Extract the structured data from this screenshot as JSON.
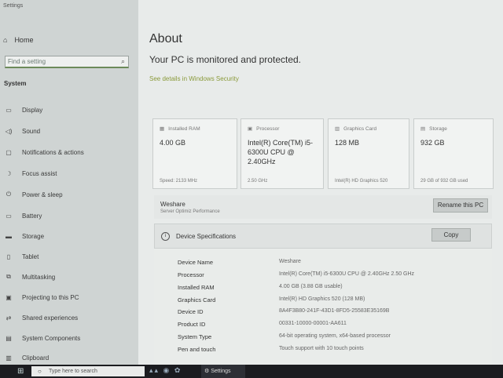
{
  "app": {
    "title": "Settings"
  },
  "sidebar": {
    "home_label": "Home",
    "search_placeholder": "Find a setting",
    "section_label": "System",
    "items": [
      {
        "label": "Display",
        "icon": "monitor-icon"
      },
      {
        "label": "Sound",
        "icon": "speaker-icon"
      },
      {
        "label": "Notifications & actions",
        "icon": "notification-icon"
      },
      {
        "label": "Focus assist",
        "icon": "moon-icon"
      },
      {
        "label": "Power & sleep",
        "icon": "power-icon"
      },
      {
        "label": "Battery",
        "icon": "battery-icon"
      },
      {
        "label": "Storage",
        "icon": "storage-icon"
      },
      {
        "label": "Tablet",
        "icon": "tablet-icon"
      },
      {
        "label": "Multitasking",
        "icon": "multitasking-icon"
      },
      {
        "label": "Projecting to this PC",
        "icon": "projector-icon"
      },
      {
        "label": "Shared experiences",
        "icon": "shared-icon"
      },
      {
        "label": "System Components",
        "icon": "components-icon"
      },
      {
        "label": "Clipboard",
        "icon": "clipboard-icon"
      }
    ]
  },
  "main": {
    "title": "About",
    "protection_status": "Your PC is monitored and protected.",
    "security_link": "See details in Windows Security",
    "cards": [
      {
        "header": "Installed RAM",
        "value": "4.00 GB",
        "footer": "Speed: 2133 MHz",
        "icon": "ram-icon"
      },
      {
        "header": "Processor",
        "value": "Intel(R) Core(TM) i5-6300U CPU @ 2.40GHz",
        "footer": "2.50 GHz",
        "icon": "processor-icon"
      },
      {
        "header": "Graphics Card",
        "value": "128 MB",
        "footer": "Intel(R) HD Graphics 520",
        "icon": "graphics-icon"
      },
      {
        "header": "Storage",
        "value": "932 GB",
        "footer": "29 GB of 932 GB used",
        "icon": "storage-icon"
      }
    ],
    "device": {
      "name": "Weshare",
      "subtitle": "Server Optimiz Performance",
      "rename_button": "Rename this PC"
    },
    "specs": {
      "title": "Device Specifications",
      "copy_button": "Copy",
      "rows": [
        {
          "key": "Device Name",
          "value": "Weshare"
        },
        {
          "key": "Processor",
          "value": "Intel(R) Core(TM) i5-6300U CPU @ 2.40GHz   2.50 GHz"
        },
        {
          "key": "Installed RAM",
          "value": "4.00 GB (3.88 GB usable)"
        },
        {
          "key": "Graphics Card",
          "value": "Intel(R) HD Graphics 520 (128 MB)"
        },
        {
          "key": "Device ID",
          "value": "8A4F3B80-241F-43D1-8FD5-25583E35169B"
        },
        {
          "key": "Product ID",
          "value": "00331-10000-00001-AA611"
        },
        {
          "key": "System Type",
          "value": "64-bit operating system, x64-based processor"
        },
        {
          "key": "Pen and touch",
          "value": "Touch support with 10 touch points"
        }
      ]
    }
  },
  "taskbar": {
    "search_placeholder": "Type here to search",
    "active_app": "Settings"
  },
  "colors": {
    "link": "#8a9a3a",
    "sidebar_bg": "#cfd4d3",
    "main_bg": "#e8ebea",
    "taskbar_bg": "#1b1c20"
  }
}
